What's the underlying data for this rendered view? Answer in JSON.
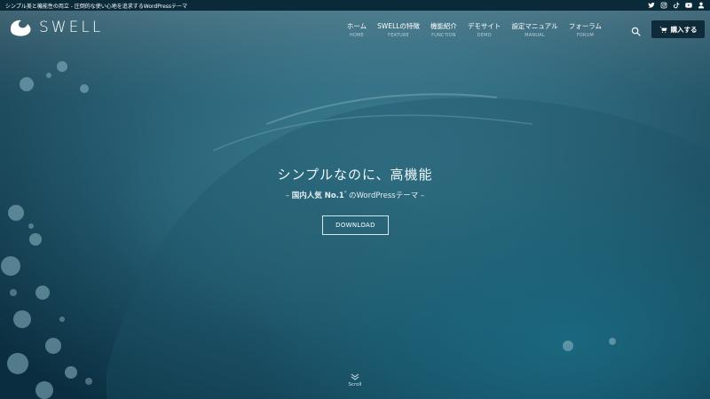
{
  "topbar": {
    "tagline": "シンプル美と機能性の両立 - 圧倒的な使い心地を追求するWordPressテーマ",
    "social_icons": [
      "twitter-icon",
      "instagram-icon",
      "tiktok-icon",
      "youtube-icon",
      "user-icon"
    ]
  },
  "logo": {
    "wordmark": "SWELL"
  },
  "nav": {
    "items": [
      {
        "ja": "ホーム",
        "en": "HOME"
      },
      {
        "ja": "SWELLの特徴",
        "en": "FEATURE"
      },
      {
        "ja": "機能紹介",
        "en": "FUNCTION"
      },
      {
        "ja": "デモサイト",
        "en": "DEMO"
      },
      {
        "ja": "設定マニュアル",
        "en": "MANUAL"
      },
      {
        "ja": "フォーラム",
        "en": "FORUM"
      }
    ]
  },
  "header": {
    "search_icon": "search-icon",
    "buy_label": "購入する",
    "buy_icon": "cart-icon"
  },
  "hero": {
    "catch": "シンプルなのに、高機能",
    "sub_prefix": "– ",
    "sub_bold": "国内人気 No.1",
    "sub_note": "*",
    "sub_rest": " のWordPressテーマ –",
    "download_label": "DOWNLOAD",
    "scroll_label": "Scroll"
  },
  "colors": {
    "topbar": "#0a2a3a",
    "buy_button": "#0f2a38",
    "water_deep": "#0d3b4f",
    "water_light": "#2f7f95"
  }
}
